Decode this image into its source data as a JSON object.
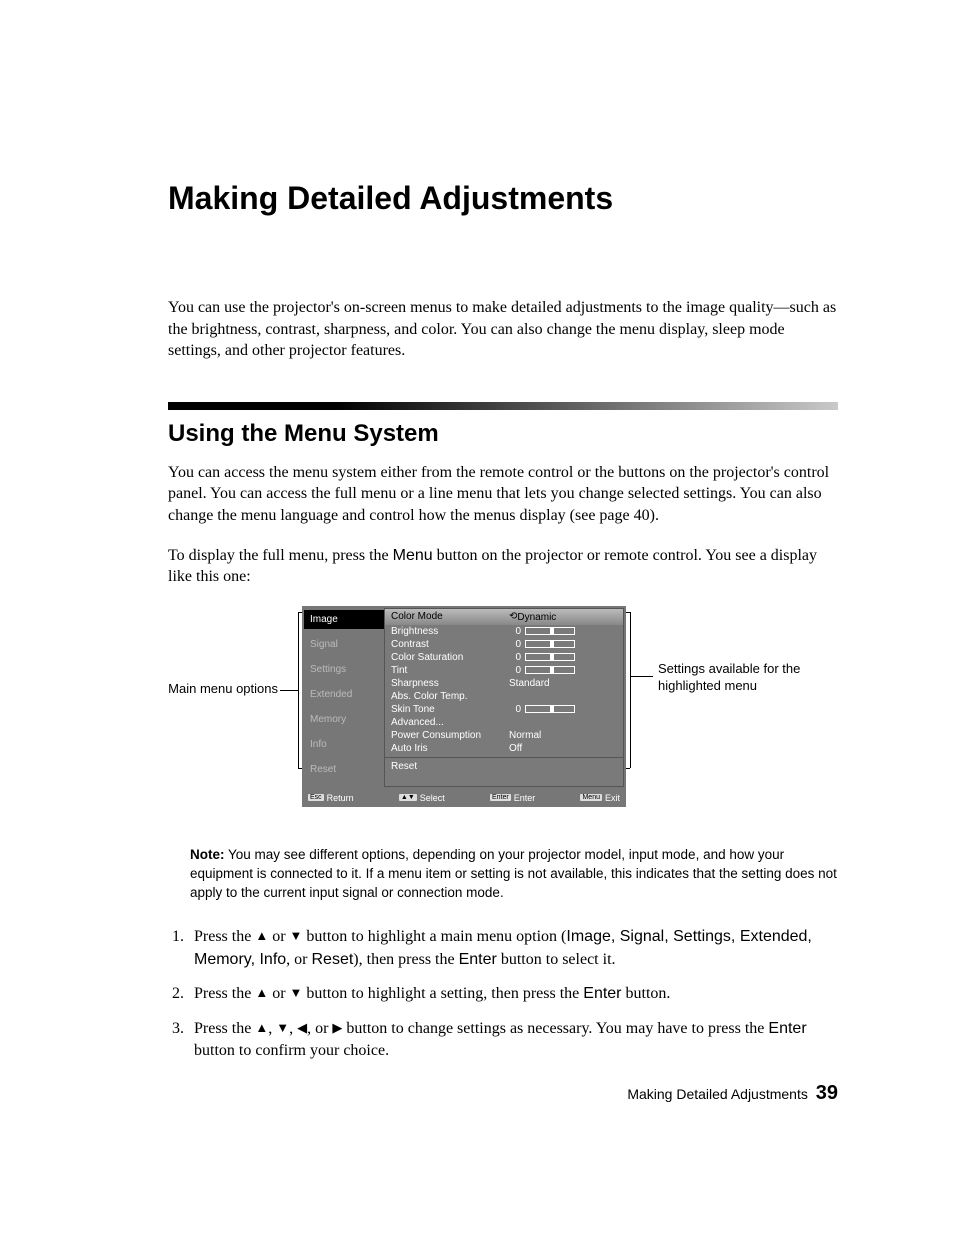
{
  "title": "Making Detailed Adjustments",
  "intro": "You can use the projector's on-screen menus to make detailed adjustments to the image quality—such as the brightness, contrast, sharpness, and color. You can also change the menu display, sleep mode settings, and other projector features.",
  "section_heading": "Using the Menu System",
  "section_p1": "You can access the menu system either from the remote control or the buttons on the projector's control panel. You can access the full menu or a line menu that lets you change selected settings. You can also change the menu language and control how the menus display (see page 40).",
  "section_p2a": "To display the full menu, press the ",
  "section_p2_btn": "Menu",
  "section_p2b": " button on the projector or remote control. You see a display like this one:",
  "callout_left": "Main menu options",
  "callout_right": "Settings available for the highlighted menu",
  "menu": {
    "left": [
      "Image",
      "Signal",
      "Settings",
      "Extended",
      "Memory",
      "Info",
      "Reset"
    ],
    "right": [
      {
        "label": "Color Mode",
        "value": "Dynamic",
        "header": true,
        "icon": true
      },
      {
        "label": "Brightness",
        "slider": "0"
      },
      {
        "label": "Contrast",
        "slider": "0"
      },
      {
        "label": "Color Saturation",
        "slider": "0"
      },
      {
        "label": "Tint",
        "slider": "0"
      },
      {
        "label": "Sharpness",
        "value": "Standard"
      },
      {
        "label": "Abs. Color Temp.",
        "value": ""
      },
      {
        "label": "Skin Tone",
        "slider": "0"
      },
      {
        "label": "Advanced...",
        "value": ""
      },
      {
        "label": "Power Consumption",
        "value": "Normal"
      },
      {
        "label": "Auto Iris",
        "value": "Off"
      }
    ],
    "reset_row": "Reset",
    "footer": {
      "return": "Return",
      "select": "Select",
      "enter": "Enter",
      "exit": "Exit",
      "k_return": "Esc",
      "k_select": "▲▼",
      "k_enter": "Enter",
      "k_exit": "Menu"
    }
  },
  "note_label": "Note:",
  "note_text": " You may see different options, depending on your projector model, input mode, and how your equipment is connected to it. If a menu item or setting is not available, this indicates that the setting does not apply to the current input signal or connection mode.",
  "steps": {
    "s1a": "Press the ",
    "s1b": " or ",
    "s1c": " button to highlight a main menu option (",
    "s1_opts": "Image, Signal, Settings, Extended, Memory, Info",
    "s1d": ", or ",
    "s1_reset": "Reset",
    "s1e": "), then press the ",
    "s1_enter": "Enter",
    "s1f": " button to select it.",
    "s2a": "Press the ",
    "s2b": " or ",
    "s2c": " button to highlight a setting, then press the ",
    "s2_enter": "Enter",
    "s2d": " button.",
    "s3a": "Press the ",
    "s3b": ", ",
    "s3c": ", ",
    "s3d": ", or ",
    "s3e": " button to change settings as necessary. You may have to press the ",
    "s3_enter": "Enter",
    "s3f": " button to confirm your choice."
  },
  "footer_text": "Making Detailed Adjustments",
  "page_number": "39"
}
